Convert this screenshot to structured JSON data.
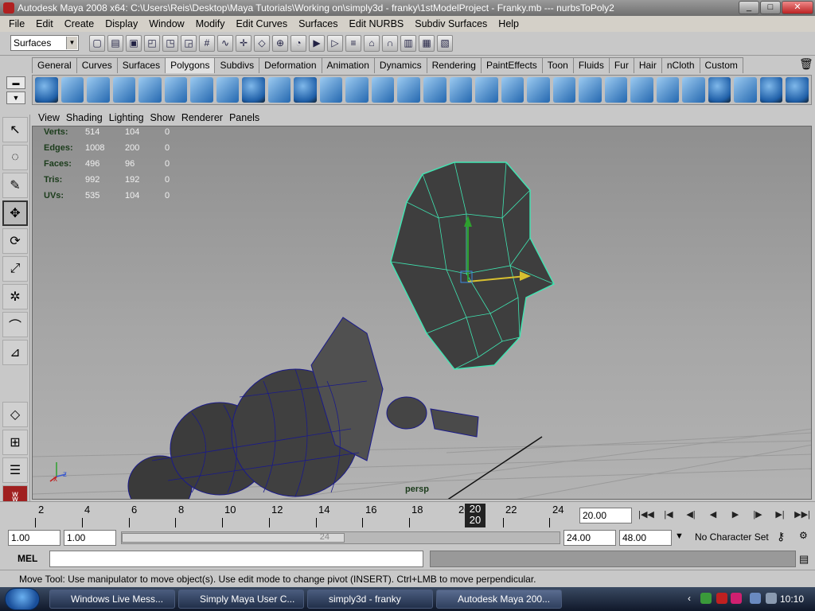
{
  "window": {
    "title": "Autodesk Maya 2008 x64: C:\\Users\\Reis\\Desktop\\Maya Tutorials\\Working on\\simply3d - franky\\1stModelProject - Franky.mb  ---  nurbsToPoly2",
    "controls": [
      "_",
      "□",
      "✕"
    ]
  },
  "menubar": [
    "File",
    "Edit",
    "Create",
    "Display",
    "Window",
    "Modify",
    "Edit Curves",
    "Surfaces",
    "Edit NURBS",
    "Subdiv Surfaces",
    "Help"
  ],
  "status_line": {
    "menu_set": "Surfaces"
  },
  "shelf_tabs": [
    "General",
    "Curves",
    "Surfaces",
    "Polygons",
    "Subdivs",
    "Deformation",
    "Animation",
    "Dynamics",
    "Rendering",
    "PaintEffects",
    "Toon",
    "Fluids",
    "Fur",
    "Hair",
    "nCloth",
    "Custom"
  ],
  "active_shelf_tab": "Polygons",
  "panel_menu": [
    "View",
    "Shading",
    "Lighting",
    "Show",
    "Renderer",
    "Panels"
  ],
  "hud": {
    "rows": [
      {
        "label": "Verts:",
        "a": "514",
        "b": "104",
        "c": "0"
      },
      {
        "label": "Edges:",
        "a": "1008",
        "b": "200",
        "c": "0"
      },
      {
        "label": "Faces:",
        "a": "496",
        "b": "96",
        "c": "0"
      },
      {
        "label": "Tris:",
        "a": "992",
        "b": "192",
        "c": "0"
      },
      {
        "label": "UVs:",
        "a": "535",
        "b": "104",
        "c": "0"
      }
    ],
    "camera": "persp"
  },
  "timeline": {
    "ticks": [
      "2",
      "4",
      "6",
      "8",
      "10",
      "12",
      "14",
      "16",
      "18",
      "20",
      "22",
      "24"
    ],
    "current_frame": "20",
    "current_time_field": "20.00"
  },
  "range": {
    "start": "1.00",
    "range_start": "1.00",
    "range_end_label": "24",
    "range_end": "24.00",
    "end": "48.00",
    "character_set": "No Character Set"
  },
  "command_line": {
    "label": "MEL"
  },
  "help_line": "Move Tool: Use manipulator to move object(s). Use edit mode to change pivot (INSERT).  Ctrl+LMB to move perpendicular.",
  "taskbar": {
    "items": [
      "Windows Live Mess...",
      "Simply Maya User C...",
      "simply3d - franky",
      "Autodesk Maya 200..."
    ],
    "clock": "10:10"
  }
}
